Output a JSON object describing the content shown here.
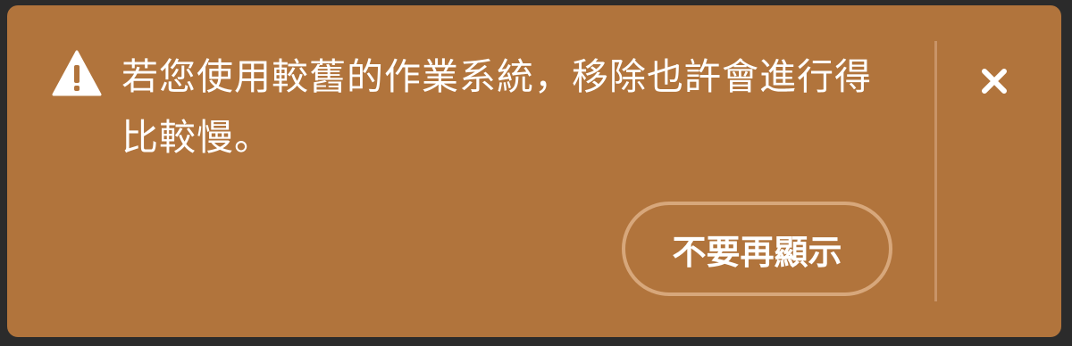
{
  "banner": {
    "background_color": "#b1743c",
    "icon": "warning-triangle-icon",
    "message": "若您使用較舊的作業系統，移除也許會進行得比較慢。",
    "dismiss_label": "不要再顯示",
    "close_icon": "close-icon"
  }
}
